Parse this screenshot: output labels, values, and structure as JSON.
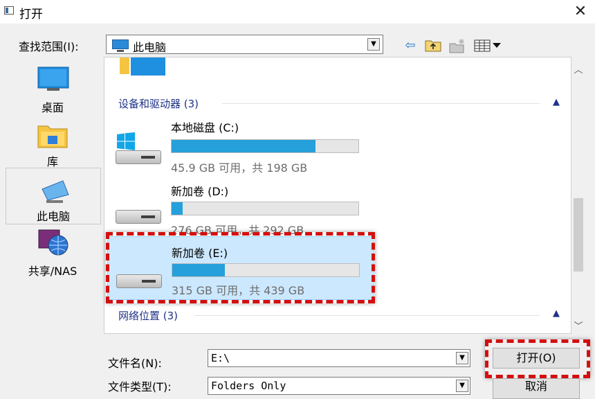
{
  "window": {
    "title": "打开",
    "close_glyph": "✕"
  },
  "toolbar": {
    "lookin_label": "查找范围(I):",
    "lookin_value": "此电脑",
    "back_icon": "back-arrow-icon",
    "up_icon": "up-folder-icon",
    "new_folder_icon": "new-folder-icon",
    "view_menu_icon": "view-menu-icon"
  },
  "places": [
    {
      "label": "桌面",
      "icon": "desktop-icon"
    },
    {
      "label": "库",
      "icon": "library-icon"
    },
    {
      "label": "此电脑",
      "icon": "computer-icon"
    },
    {
      "label": "共享/NAS",
      "icon": "network-share-icon"
    }
  ],
  "list": {
    "groups": [
      {
        "title": "设备和驱动器 (3)"
      },
      {
        "title": "网络位置 (3)"
      }
    ],
    "drives": [
      {
        "name": "本地磁盘 (C:)",
        "free_text": "45.9 GB 可用，共 198 GB",
        "used_fraction": 0.77
      },
      {
        "name": "新加卷 (D:)",
        "free_text": "276 GB 可用，共 292 GB",
        "used_fraction": 0.06
      },
      {
        "name": "新加卷 (E:)",
        "free_text": "315 GB 可用，共 439 GB",
        "used_fraction": 0.28
      }
    ]
  },
  "bottom": {
    "filename_label": "文件名(N):",
    "filename_value": "E:\\",
    "filetype_label": "文件类型(T):",
    "filetype_value": "Folders Only",
    "open_button": "打开(O)",
    "cancel_button": "取消"
  },
  "colors": {
    "accent": "#26a0da",
    "selection": "#cce8ff",
    "highlight": "#d40f0f",
    "group_header": "#1e3287"
  }
}
